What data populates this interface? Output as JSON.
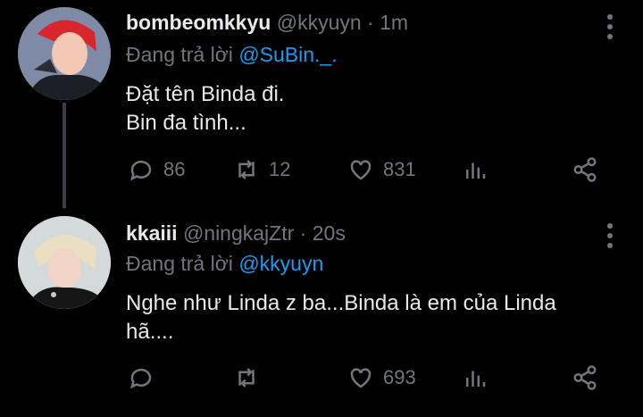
{
  "tweets": [
    {
      "name": "bombeomkkyu",
      "handle": "@kkyuyn",
      "separator": "·",
      "time": "1m",
      "reply_prefix": "Đang trả lời",
      "reply_to": "@SuBin._.",
      "lines": [
        "Đặt tên Binda đi.",
        "Bin đa tình..."
      ],
      "replies": "86",
      "retweets": "12",
      "likes": "831"
    },
    {
      "name": "kkaiii",
      "handle": "@ningkajZtr",
      "separator": "·",
      "time": "20s",
      "reply_prefix": "Đang trả lời",
      "reply_to": "@kkyuyn",
      "lines": [
        "Nghe như Linda z ba...Binda là em của Linda",
        "hã...."
      ],
      "replies": "",
      "retweets": "",
      "likes": "693"
    }
  ],
  "icons": {
    "reply": "reply-icon",
    "retweet": "retweet-icon",
    "like": "heart-icon",
    "stats": "analytics-icon",
    "share": "share-icon",
    "more": "more-icon"
  },
  "colors": {
    "background": "#000000",
    "text": "#e7e9ea",
    "muted": "#71767b",
    "mention": "#1d9bf0"
  }
}
